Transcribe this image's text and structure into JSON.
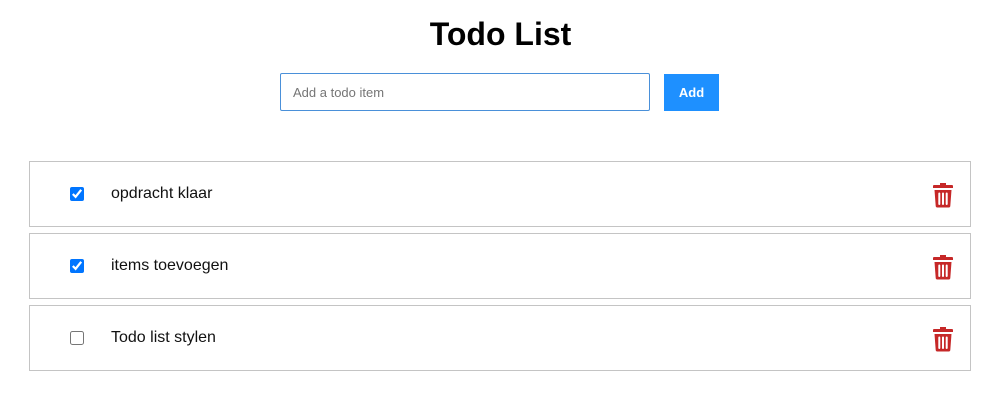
{
  "header": {
    "title": "Todo List"
  },
  "add_form": {
    "input_placeholder": "Add a todo item",
    "input_value": "",
    "add_label": "Add",
    "accent_color": "#1e90ff"
  },
  "todos": [
    {
      "text": "opdracht klaar",
      "checked": true,
      "delete_icon": "trash-icon"
    },
    {
      "text": "items toevoegen",
      "checked": true,
      "delete_icon": "trash-icon"
    },
    {
      "text": "Todo list stylen",
      "checked": false,
      "delete_icon": "trash-icon"
    }
  ],
  "colors": {
    "delete_icon": "#c62828",
    "item_border": "#c4c4c4"
  }
}
